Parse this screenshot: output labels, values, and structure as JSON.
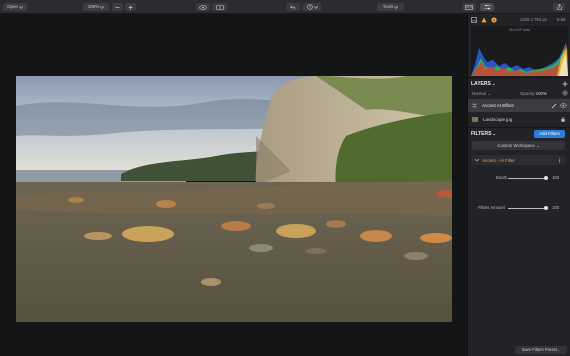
{
  "toolbar": {
    "open_label": "Open",
    "zoom_label": "168%",
    "tools_label": "Tools"
  },
  "panel": {
    "dimensions": "1326 x 763 px",
    "bit_depth": "8-bit",
    "exif_note": "No EXIF data",
    "layers_title": "LAYERS",
    "blend_mode": "Normal",
    "opacity_label": "Opacity",
    "opacity_value": "100%",
    "layers": [
      {
        "name": "Accent AI Effect"
      },
      {
        "name": "Landscape.jpg"
      }
    ],
    "filters_title": "FILTERS",
    "add_filters_label": "Add Filters",
    "workspace_label": "Custom Workspace",
    "filter_name": "Accent - AI Filter",
    "sliders": [
      {
        "label": "Boost",
        "value": "100",
        "level": 1.0
      },
      {
        "label": "Filters Amount",
        "value": "100",
        "level": 1.0
      }
    ],
    "save_preset_label": "Save Filters Preset..."
  },
  "colors": {
    "accent": "#2f7bd8",
    "panel_bg": "#222326",
    "topbar_bg": "#2b2c2f"
  }
}
